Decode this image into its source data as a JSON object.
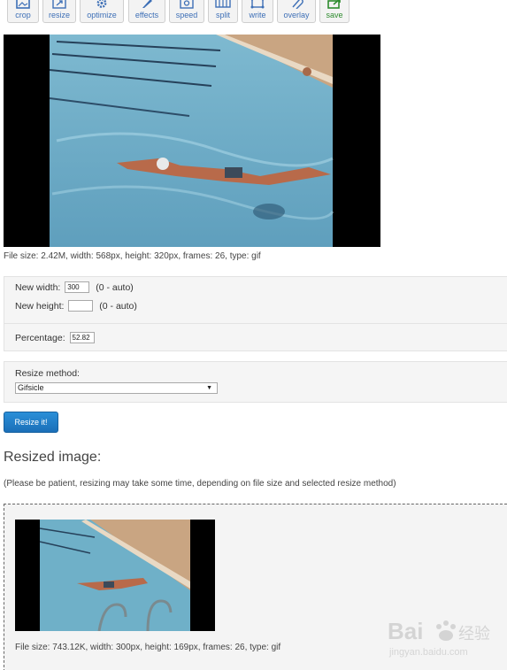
{
  "toolbar": {
    "items": [
      {
        "label": "crop",
        "icon": "crop-icon"
      },
      {
        "label": "resize",
        "icon": "resize-icon"
      },
      {
        "label": "optimize",
        "icon": "gear-icon"
      },
      {
        "label": "effects",
        "icon": "brush-icon"
      },
      {
        "label": "speed",
        "icon": "speed-icon"
      },
      {
        "label": "split",
        "icon": "film-icon"
      },
      {
        "label": "write",
        "icon": "text-icon"
      },
      {
        "label": "overlay",
        "icon": "paperclip-icon"
      },
      {
        "label": "save",
        "icon": "save-icon"
      }
    ]
  },
  "preview": {
    "info": "File size: 2.42M, width: 568px, height: 320px, frames: 26, type: gif"
  },
  "resize_form": {
    "new_width_label": "New width:",
    "new_width_value": "300",
    "new_width_hint": "(0 - auto)",
    "new_height_label": "New height:",
    "new_height_value": "",
    "new_height_hint": "(0 - auto)",
    "percentage_label": "Percentage:",
    "percentage_value": "52.82",
    "method_label": "Resize method:",
    "method_value": "Gifsicle",
    "submit_label": "Resize it!"
  },
  "result": {
    "title": "Resized image:",
    "note": "(Please be patient, resizing may take some time, depending on file size and selected resize method)",
    "info": "File size: 743.12K, width: 300px, height: 169px, frames: 26, type: gif"
  },
  "watermark": {
    "brand": "Bai",
    "brand_cn": "经验",
    "url": "jingyan.baidu.com"
  },
  "colors": {
    "accent": "#1b6fb8",
    "tool_label": "#3d6fb6",
    "save_label": "#2e8b2e",
    "panel_bg": "#f5f5f5"
  }
}
